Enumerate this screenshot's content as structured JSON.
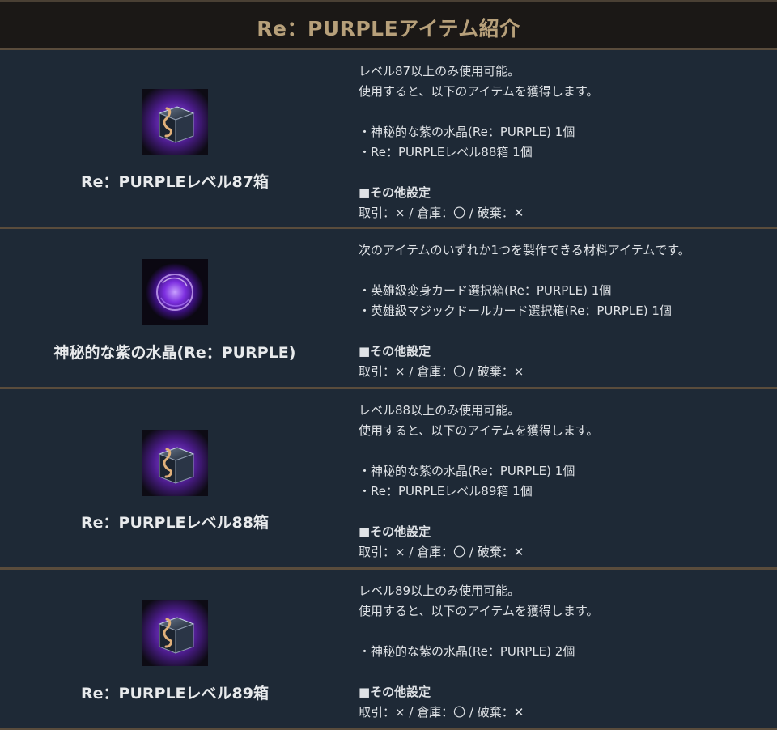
{
  "header": {
    "title": "Re：PURPLEアイテム紹介"
  },
  "colors": {
    "accent_title": "#b7a07a",
    "background": "#1e2936",
    "divider": "#5a4c3c"
  },
  "items": [
    {
      "name": "Re：PURPLEレベル87箱",
      "icon": "purple-treasure-box-icon",
      "lines": [
        "レベル87以上のみ使用可能。",
        "使用すると、以下のアイテムを獲得します。",
        "",
        "・神秘的な紫の水晶(Re：PURPLE) 1個",
        "・Re：PURPLEレベル88箱 1個",
        ""
      ],
      "settings_title": "■その他設定",
      "settings": "取引：× / 倉庫：〇 / 破棄：✕"
    },
    {
      "name": "神秘的な紫の水晶(Re：PURPLE)",
      "icon": "purple-crystal-orb-icon",
      "lines": [
        "次のアイテムのいずれか1つを製作できる材料アイテムです。",
        "",
        "・英雄級変身カード選択箱(Re：PURPLE) 1個",
        "・英雄級マジックドールカード選択箱(Re：PURPLE) 1個",
        ""
      ],
      "settings_title": "■その他設定",
      "settings": "取引：× / 倉庫：〇 / 破棄：×"
    },
    {
      "name": "Re：PURPLEレベル88箱",
      "icon": "purple-treasure-box-icon",
      "lines": [
        "レベル88以上のみ使用可能。",
        "使用すると、以下のアイテムを獲得します。",
        "",
        "・神秘的な紫の水晶(Re：PURPLE) 1個",
        "・Re：PURPLEレベル89箱 1個",
        ""
      ],
      "settings_title": "■その他設定",
      "settings": "取引：× / 倉庫：〇 / 破棄：✕"
    },
    {
      "name": "Re：PURPLEレベル89箱",
      "icon": "purple-treasure-box-icon",
      "lines": [
        "レベル89以上のみ使用可能。",
        "使用すると、以下のアイテムを獲得します。",
        "",
        "・神秘的な紫の水晶(Re：PURPLE) 2個",
        ""
      ],
      "settings_title": "■その他設定",
      "settings": "取引：× / 倉庫：〇 / 破棄：✕"
    }
  ]
}
